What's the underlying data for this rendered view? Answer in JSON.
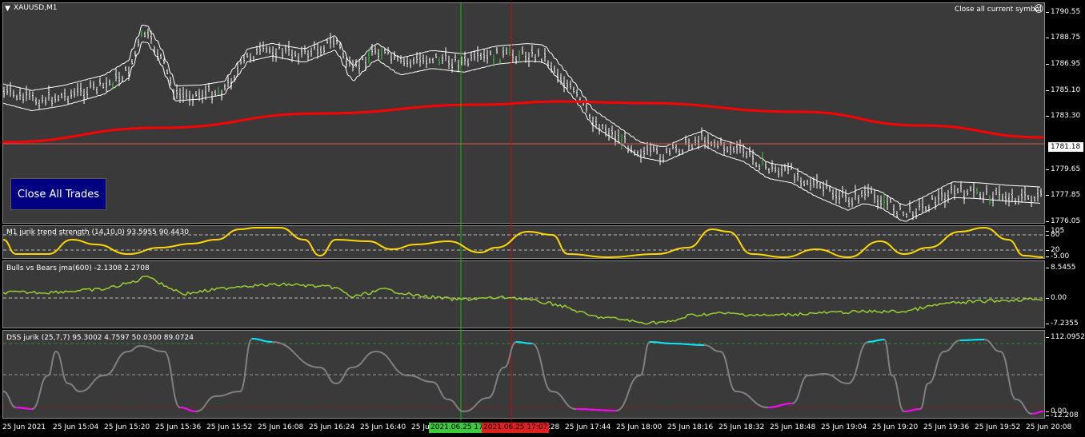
{
  "main": {
    "symbol_label": "XAUUSD,M1",
    "close_symbol_label": "Close all current symbol",
    "close_all_button": "Close All Trades",
    "current_price": "1781.18",
    "y_labels": [
      "1790.55",
      "1788.75",
      "1786.95",
      "1785.10",
      "1783.30",
      "1779.65",
      "1777.85",
      "1776.05"
    ]
  },
  "indicator1": {
    "label": "M1 jurik trend strength (14,10,0) 93.5955 90.4430",
    "y_labels": [
      "105",
      "80",
      "20",
      "-5.00"
    ],
    "line_color": "#ffd700"
  },
  "indicator2": {
    "label": "Bulls vs Bears jma(600) -2.1308 2.2708",
    "y_labels": [
      "8.5455",
      "0.00",
      "-7.2355"
    ],
    "line_color": "#9acd32"
  },
  "indicator3": {
    "label": "DSS jurik (25,7,7) 95.3002 4.7597 50.0300 89.0724",
    "y_labels": [
      "112.0952",
      "0.00",
      "-12.208"
    ],
    "colors": {
      "mid": "#808080",
      "high": "#00e5ff",
      "low": "#ff00ff"
    }
  },
  "x_axis": {
    "labels": [
      "25 Jun 2021",
      "25 Jun 15:04",
      "25 Jun 15:20",
      "25 Jun 15:36",
      "25 Jun 15:52",
      "25 Jun 16:08",
      "25 Jun 16:24",
      "25 Jun 16:40",
      "25 Jun",
      "7:28",
      "25 Jun 17:44",
      "25 Jun 18:00",
      "25 Jun 18:16",
      "25 Jun 18:32",
      "25 Jun 18:48",
      "25 Jun 19:04",
      "25 Jun 19:20",
      "25 Jun 19:36",
      "25 Jun 19:52",
      "25 Jun 20:08"
    ],
    "green_badge": "2021.06.25 17",
    "red_badge": "2021.06.25 17:07"
  },
  "colors": {
    "background": "#3a3a3a",
    "ma_red": "#ff0000",
    "green_cursor": "#00c800",
    "red_cursor": "#e00000"
  }
}
